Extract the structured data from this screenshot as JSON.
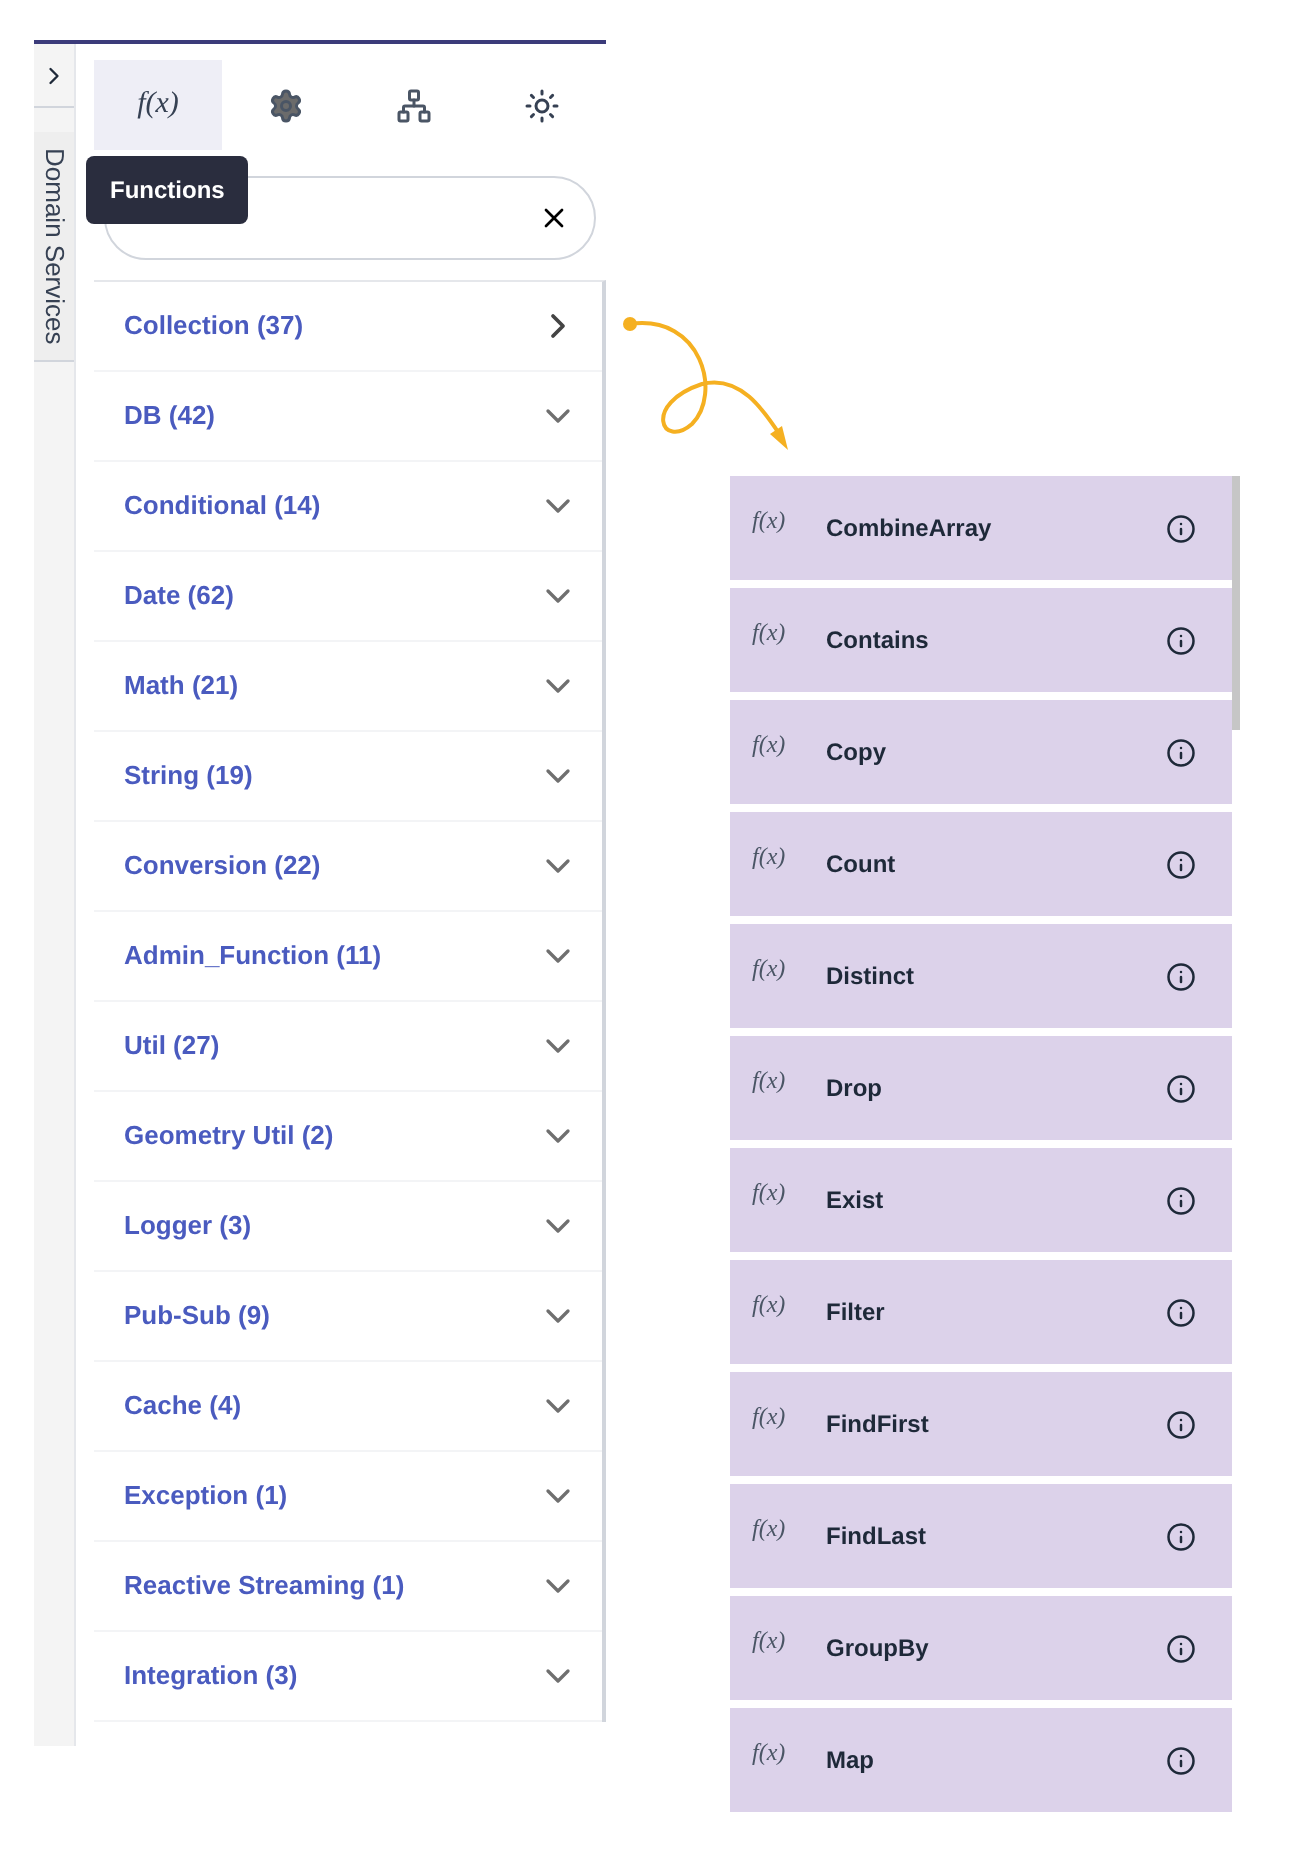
{
  "side_tab": {
    "label": "Domain Services"
  },
  "tabs": [
    {
      "kind": "fx",
      "label": "f(x)",
      "selected": true
    },
    {
      "kind": "gear",
      "selected": false
    },
    {
      "kind": "nodes",
      "selected": false
    },
    {
      "kind": "sun",
      "selected": false
    }
  ],
  "tooltip": "Functions",
  "categories": [
    {
      "label": "Collection (37)",
      "selected": true
    },
    {
      "label": "DB (42)",
      "selected": false
    },
    {
      "label": "Conditional (14)",
      "selected": false
    },
    {
      "label": "Date (62)",
      "selected": false
    },
    {
      "label": "Math (21)",
      "selected": false
    },
    {
      "label": "String (19)",
      "selected": false
    },
    {
      "label": "Conversion (22)",
      "selected": false
    },
    {
      "label": "Admin_Function (11)",
      "selected": false
    },
    {
      "label": "Util (27)",
      "selected": false
    },
    {
      "label": "Geometry Util (2)",
      "selected": false
    },
    {
      "label": "Logger (3)",
      "selected": false
    },
    {
      "label": "Pub-Sub (9)",
      "selected": false
    },
    {
      "label": "Cache (4)",
      "selected": false
    },
    {
      "label": "Exception (1)",
      "selected": false
    },
    {
      "label": "Reactive Streaming (1)",
      "selected": false
    },
    {
      "label": "Integration (3)",
      "selected": false
    }
  ],
  "functions": [
    {
      "badge": "f(x)",
      "name": "CombineArray"
    },
    {
      "badge": "f(x)",
      "name": "Contains"
    },
    {
      "badge": "f(x)",
      "name": "Copy"
    },
    {
      "badge": "f(x)",
      "name": "Count"
    },
    {
      "badge": "f(x)",
      "name": "Distinct"
    },
    {
      "badge": "f(x)",
      "name": "Drop"
    },
    {
      "badge": "f(x)",
      "name": "Exist"
    },
    {
      "badge": "f(x)",
      "name": "Filter"
    },
    {
      "badge": "f(x)",
      "name": "FindFirst"
    },
    {
      "badge": "f(x)",
      "name": "FindLast"
    },
    {
      "badge": "f(x)",
      "name": "GroupBy"
    },
    {
      "badge": "f(x)",
      "name": "Map"
    }
  ]
}
